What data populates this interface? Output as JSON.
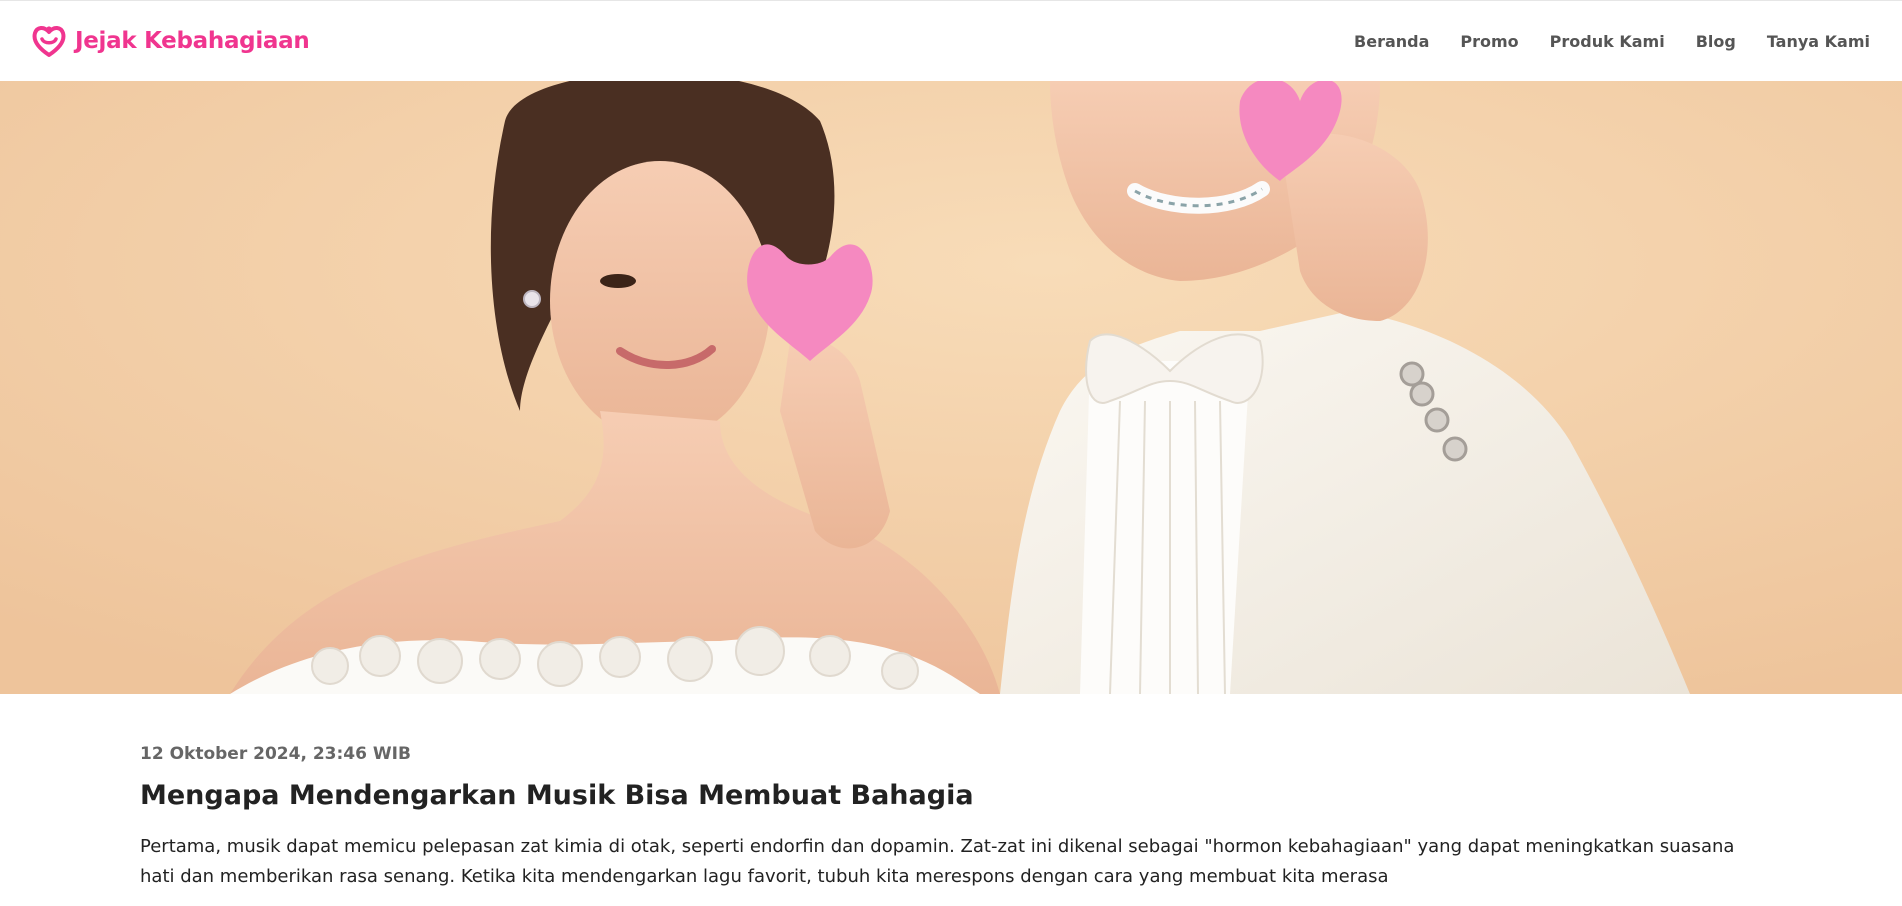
{
  "brand": {
    "name": "Jejak Kebahagiaan",
    "icon": "heart-logo-icon",
    "color": "#f0358f"
  },
  "nav": {
    "items": [
      {
        "label": "Beranda"
      },
      {
        "label": "Promo"
      },
      {
        "label": "Produk Kami"
      },
      {
        "label": "Blog"
      },
      {
        "label": "Tanya Kami"
      }
    ]
  },
  "hero": {
    "background_color": "#f2cfa8"
  },
  "article": {
    "date": "12 Oktober 2024, 23:46 WIB",
    "title": "Mengapa Mendengarkan Musik Bisa Membuat Bahagia",
    "body": "Pertama, musik dapat memicu pelepasan zat kimia di otak, seperti endorfin dan dopamin. Zat-zat ini dikenal sebagai \"hormon kebahagiaan\" yang dapat meningkatkan suasana hati dan memberikan rasa senang. Ketika kita mendengarkan lagu favorit, tubuh kita merespons dengan cara yang membuat kita merasa"
  }
}
